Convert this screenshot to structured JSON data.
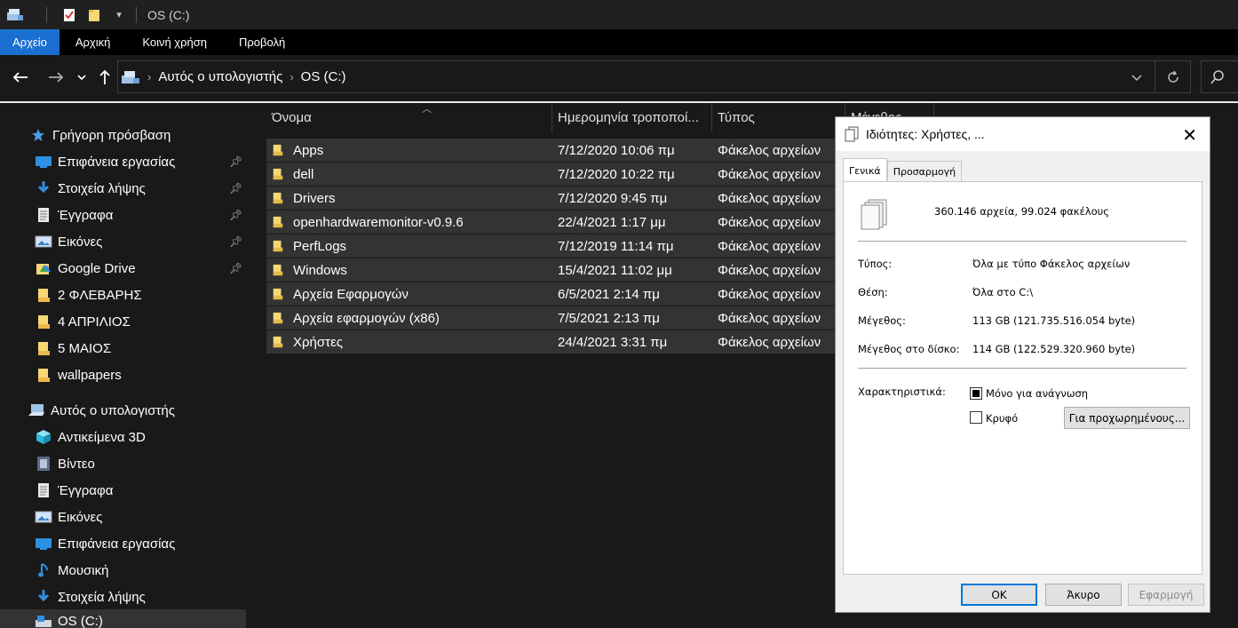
{
  "window": {
    "title": "OS (C:)"
  },
  "ribbon": {
    "tabs": [
      "Αρχείο",
      "Αρχική",
      "Κοινή χρήση",
      "Προβολή"
    ]
  },
  "address": {
    "crumbs": [
      "Αυτός ο υπολογιστής",
      "OS (C:)"
    ]
  },
  "sidebar": {
    "items": [
      {
        "label": "Γρήγορη πρόσβαση",
        "icon": "star-icon",
        "pinned": false
      },
      {
        "label": "Επιφάνεια εργασίας",
        "icon": "desktop-icon",
        "pinned": true
      },
      {
        "label": "Στοιχεία λήψης",
        "icon": "download-icon",
        "pinned": true
      },
      {
        "label": "Έγγραφα",
        "icon": "documents-icon",
        "pinned": true
      },
      {
        "label": "Εικόνες",
        "icon": "pictures-icon",
        "pinned": true
      },
      {
        "label": "Google Drive",
        "icon": "google-drive-icon",
        "pinned": true
      },
      {
        "label": "2 ΦΛΕΒΑΡΗΣ",
        "icon": "folder-icon",
        "pinned": false
      },
      {
        "label": "4 ΑΠΡΙΛΙΟΣ",
        "icon": "folder-icon",
        "pinned": false
      },
      {
        "label": "5 ΜΑΙΟΣ",
        "icon": "folder-icon",
        "pinned": false
      },
      {
        "label": "wallpapers",
        "icon": "folder-icon",
        "pinned": false
      },
      {
        "label": "Αυτός ο υπολογιστής",
        "icon": "computer-icon",
        "pinned": false
      },
      {
        "label": "Αντικείμενα 3D",
        "icon": "cube-3d-icon",
        "pinned": false
      },
      {
        "label": "Βίντεο",
        "icon": "video-icon",
        "pinned": false
      },
      {
        "label": "Έγγραφα",
        "icon": "documents-icon",
        "pinned": false
      },
      {
        "label": "Εικόνες",
        "icon": "pictures-icon",
        "pinned": false
      },
      {
        "label": "Επιφάνεια εργασίας",
        "icon": "desktop-icon",
        "pinned": false
      },
      {
        "label": "Μουσική",
        "icon": "music-icon",
        "pinned": false
      },
      {
        "label": "Στοιχεία λήψης",
        "icon": "download-icon",
        "pinned": false
      },
      {
        "label": "OS (C:)",
        "icon": "drive-icon",
        "pinned": false
      }
    ]
  },
  "columns": [
    "Όνομα",
    "Ημερομηνία τροποποί...",
    "Τύπος",
    "Μέγεθος"
  ],
  "files": [
    {
      "name": "Apps",
      "date": "7/12/2020 10:06 πμ",
      "type": "Φάκελος αρχείων"
    },
    {
      "name": "dell",
      "date": "7/12/2020 10:22 πμ",
      "type": "Φάκελος αρχείων"
    },
    {
      "name": "Drivers",
      "date": "7/12/2020 9:45 πμ",
      "type": "Φάκελος αρχείων"
    },
    {
      "name": "openhardwaremonitor-v0.9.6",
      "date": "22/4/2021 1:17 μμ",
      "type": "Φάκελος αρχείων"
    },
    {
      "name": "PerfLogs",
      "date": "7/12/2019 11:14 πμ",
      "type": "Φάκελος αρχείων"
    },
    {
      "name": "Windows",
      "date": "15/4/2021 11:02 μμ",
      "type": "Φάκελος αρχείων"
    },
    {
      "name": "Αρχεία Εφαρμογών",
      "date": "6/5/2021 2:14 πμ",
      "type": "Φάκελος αρχείων"
    },
    {
      "name": "Αρχεία εφαρμογών (x86)",
      "date": "7/5/2021 2:13 πμ",
      "type": "Φάκελος αρχείων"
    },
    {
      "name": "Χρήστες",
      "date": "24/4/2021 3:31 πμ",
      "type": "Φάκελος αρχείων"
    }
  ],
  "dialog": {
    "title": "Ιδιότητες: Χρήστες, ...",
    "tabs": [
      "Γενικά",
      "Προσαρμογή"
    ],
    "summary": "360.146 αρχεία, 99.024 φακέλους",
    "props": [
      {
        "label": "Τύπος:",
        "value": "Όλα με τύπο Φάκελος αρχείων"
      },
      {
        "label": "Θέση:",
        "value": "Όλα στο C:\\"
      },
      {
        "label": "Μέγεθος:",
        "value": "113 GB (121.735.516.054 byte)"
      },
      {
        "label": "Μέγεθος στο δίσκο:",
        "value": "114 GB (122.529.320.960 byte)"
      }
    ],
    "attributes_label": "Χαρακτηριστικά:",
    "readonly_label": "Μόνο για ανάγνωση",
    "readonly_state": "indeterminate",
    "hidden_label": "Κρυφό",
    "hidden_state": "unchecked",
    "advanced_label": "Για προχωρημένους...",
    "ok_label": "OK",
    "cancel_label": "Άκυρο",
    "apply_label": "Εφαρμογή"
  }
}
